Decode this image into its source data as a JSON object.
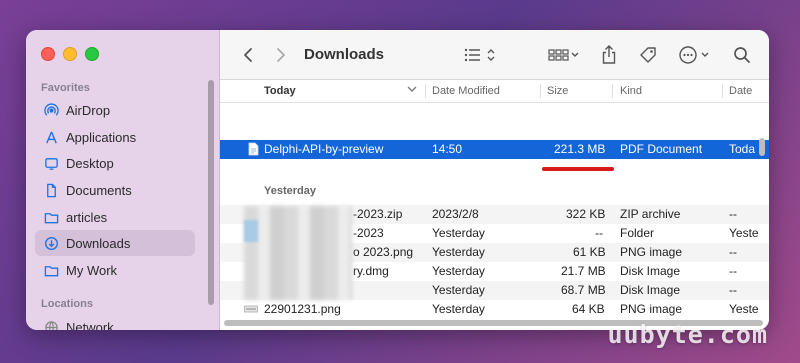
{
  "sidebar": {
    "favorites_title": "Favorites",
    "items": [
      {
        "label": "AirDrop",
        "icon": "airdrop-icon"
      },
      {
        "label": "Applications",
        "icon": "applications-icon"
      },
      {
        "label": "Desktop",
        "icon": "desktop-icon"
      },
      {
        "label": "Documents",
        "icon": "document-icon"
      },
      {
        "label": "articles",
        "icon": "folder-icon"
      },
      {
        "label": "Downloads",
        "icon": "download-icon",
        "selected": true
      },
      {
        "label": "My Work",
        "icon": "folder-icon"
      }
    ],
    "locations_title": "Locations",
    "locations": [
      {
        "label": "Network",
        "icon": "network-icon"
      }
    ]
  },
  "toolbar": {
    "title": "Downloads"
  },
  "columns": {
    "name": "Today",
    "date": "Date Modified",
    "size": "Size",
    "kind": "Kind",
    "added": "Date"
  },
  "today_rows": [
    {
      "name": "Delphi-API-by-preview",
      "date": "14:50",
      "size": "221.3 MB",
      "kind": "PDF Document",
      "added": "Toda"
    }
  ],
  "yesterday_label": "Yesterday",
  "yesterday_rows": [
    {
      "name": "-2023.zip",
      "date": "2023/2/8",
      "size": "322 KB",
      "kind": "ZIP archive",
      "added": "--"
    },
    {
      "name": "-2023",
      "date": "Yesterday",
      "size": "--",
      "kind": "Folder",
      "added": "Yeste"
    },
    {
      "name": "o 2023.png",
      "date": "Yesterday",
      "size": "61 KB",
      "kind": "PNG image",
      "added": "--"
    },
    {
      "name": "ry.dmg",
      "date": "Yesterday",
      "size": "21.7 MB",
      "kind": "Disk Image",
      "added": "--"
    },
    {
      "name": "",
      "date": "Yesterday",
      "size": "68.7 MB",
      "kind": "Disk Image",
      "added": "--"
    },
    {
      "name": "22901231.png",
      "date": "Yesterday",
      "size": "64 KB",
      "kind": "PNG image",
      "added": "Yeste"
    }
  ],
  "watermark": "uubyte.com"
}
